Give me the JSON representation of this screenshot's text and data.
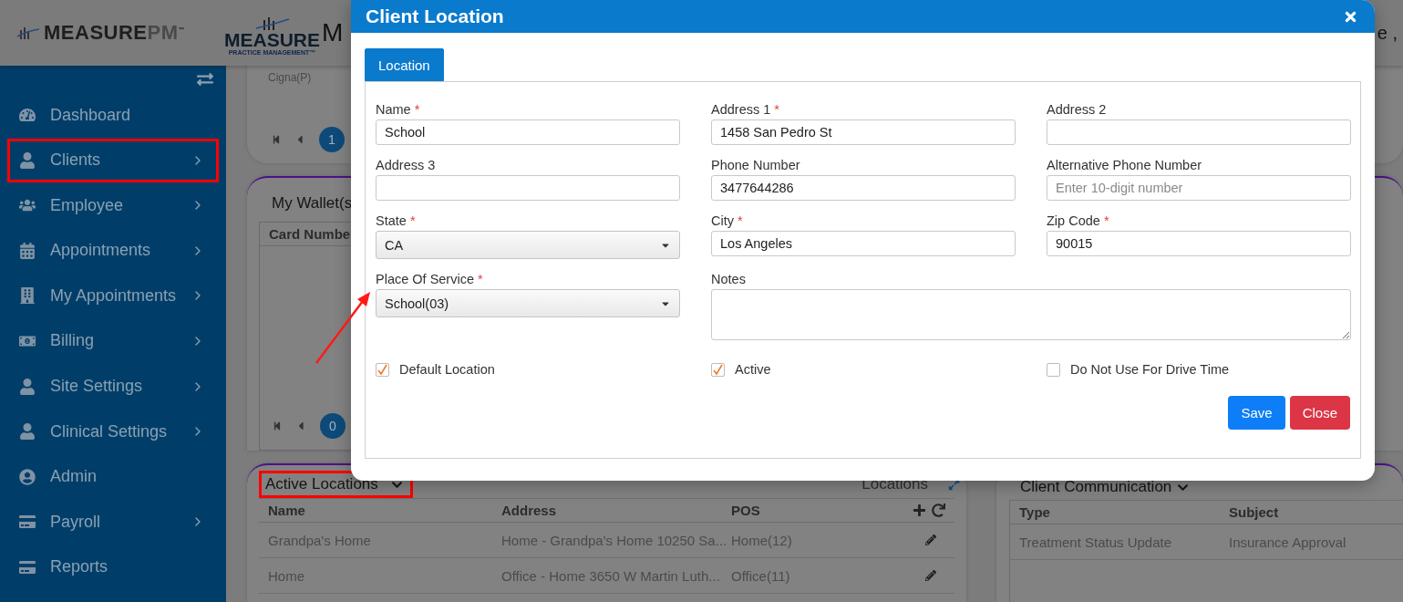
{
  "header": {
    "logo": {
      "name": "MEASURE",
      "suffix": "PM",
      "tm": "™"
    },
    "brand": {
      "name": "MEASURE",
      "tagline": "PRACTICE MANAGEMENT™"
    },
    "title_fragment": "M",
    "right_fragment": "e ,"
  },
  "sidebar": {
    "items": [
      {
        "label": "Dashboard",
        "has_submenu": false,
        "annotated": false
      },
      {
        "label": "Clients",
        "has_submenu": true,
        "annotated": true
      },
      {
        "label": "Employee",
        "has_submenu": true,
        "annotated": false
      },
      {
        "label": "Appointments",
        "has_submenu": true,
        "annotated": false
      },
      {
        "label": "My Appointments",
        "has_submenu": true,
        "annotated": false
      },
      {
        "label": "Billing",
        "has_submenu": true,
        "annotated": false
      },
      {
        "label": "Site Settings",
        "has_submenu": true,
        "annotated": false
      },
      {
        "label": "Clinical Settings",
        "has_submenu": true,
        "annotated": false
      },
      {
        "label": "Admin",
        "has_submenu": false,
        "annotated": false
      },
      {
        "label": "Payroll",
        "has_submenu": true,
        "annotated": false
      },
      {
        "label": "Reports",
        "has_submenu": false,
        "annotated": false
      }
    ]
  },
  "insurance_card": {
    "fragment": "Cigna(P)",
    "page": "1"
  },
  "wallet": {
    "title": "My Wallet(s",
    "column": "Card Numbe",
    "page": "0"
  },
  "locations": {
    "title": "Active Locations",
    "annotated": true,
    "caption": "Locations",
    "columns": [
      "Name",
      "Address",
      "POS"
    ],
    "rows": [
      {
        "name": "Grandpa's Home",
        "address": "Home - Grandpa's Home 10250 Sa...",
        "pos": "Home(12)"
      },
      {
        "name": "Home",
        "address": "Office - Home 3650 W Martin Luth...",
        "pos": "Office(11)"
      }
    ]
  },
  "communication": {
    "title": "Client Communication",
    "columns": [
      "Type",
      "Subject"
    ],
    "rows": [
      {
        "type": "Treatment Status Update",
        "subject": "Insurance Approval"
      }
    ]
  },
  "modal": {
    "title": "Client Location",
    "tabs": [
      {
        "label": "Location",
        "selected": true
      }
    ],
    "fields": [
      {
        "label": "Name",
        "required_mark": "*",
        "kind": "input",
        "value": "School"
      },
      {
        "label": "Address 1",
        "required_mark": "*",
        "kind": "input",
        "value": "1458 San Pedro St"
      },
      {
        "label": "Address 2",
        "kind": "input"
      },
      {
        "label": "Address 3",
        "kind": "input"
      },
      {
        "label": "Phone Number",
        "kind": "input",
        "value": "3477644286"
      },
      {
        "label": "Alternative Phone Number",
        "kind": "input",
        "placeholder": "Enter 10-digit number"
      },
      {
        "label": "State",
        "required_mark": "*",
        "kind": "select",
        "value": "CA"
      },
      {
        "label": "City",
        "required_mark": "*",
        "kind": "input",
        "value": "Los Angeles"
      },
      {
        "label": "Zip Code",
        "required_mark": "*",
        "kind": "input",
        "value": "90015"
      },
      {
        "label": "Place Of Service",
        "required_mark": "*",
        "kind": "select",
        "value": "School(03)"
      },
      {
        "label": "Notes",
        "kind": "textarea"
      }
    ],
    "checkboxes": [
      {
        "label": "Default Location",
        "checked": true
      },
      {
        "label": "Active",
        "checked": true
      },
      {
        "label": "Do Not Use For Drive Time",
        "checked": false
      }
    ],
    "buttons": [
      {
        "label": "Save",
        "kind": "primary"
      },
      {
        "label": "Close",
        "kind": "danger"
      }
    ]
  }
}
